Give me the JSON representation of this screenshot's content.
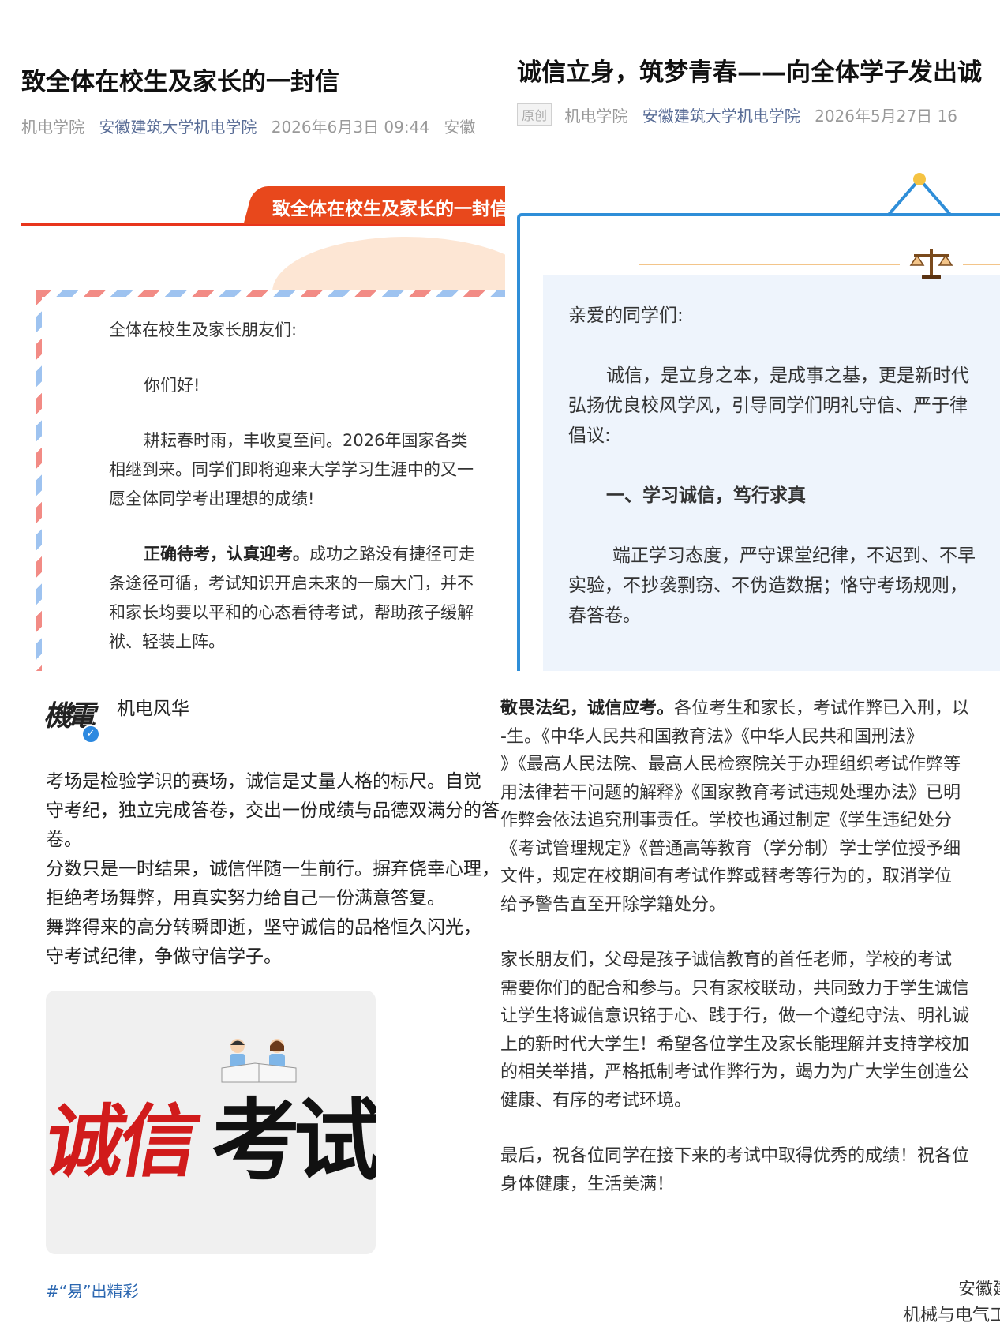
{
  "top_left": {
    "title": "致全体在校生及家长的一封信",
    "meta_source": "机电学院",
    "meta_account": "安徽建筑大学机电学院",
    "meta_date": "2026年6月3日 09:44",
    "meta_region": "安徽",
    "banner_text": "致全体在校生及家长的一封信",
    "salutation": "全体在校生及家长朋友们:",
    "greeting": "你们好!",
    "para1_line1": "耕耘春时雨，丰收夏至间。2026年国家各类",
    "para1_line2": "相继到来。同学们即将迎来大学学习生涯中的又一",
    "para1_line3": "愿全体同学考出理想的成绩!",
    "para2_bold": "正确待考，认真迎考。",
    "para2_line1_rest": "成功之路没有捷径可走",
    "para2_line2": "条途径可循，考试知识开启未来的一扇大门，并不",
    "para2_line3": "和家长均要以平和的心态看待考试，帮助孩子缓解",
    "para2_line4": "袱、轻装上阵。"
  },
  "top_right": {
    "title": "诚信立身，筑梦青春——向全体学子发出诚",
    "meta_tag": "原创",
    "meta_source": "机电学院",
    "meta_account": "安徽建筑大学机电学院",
    "meta_date": "2026年5月27日 16",
    "salutation": "亲爱的同学们:",
    "para1_line1": "诚信，是立身之本，是成事之基，更是新时代",
    "para1_line2": "弘扬优良校风学风，引导同学们明礼守信、严于律",
    "para1_line3": "倡议:",
    "heading1": "一、学习诚信，笃行求真",
    "para2_line1": "端正学习态度，严守课堂纪律，不迟到、不早",
    "para2_line2": "实验，不抄袭剽窃、不伪造数据；恪守考场规则，",
    "para2_line3": "春答卷。"
  },
  "bottom_left": {
    "account_name": "机电风华",
    "logo_text": "機電",
    "post_lines": [
      "考场是检验学识的赛场，诚信是丈量人格的标尺。自觉",
      "守考纪，独立完成答卷，交出一份成绩与品德双满分的答",
      "卷。",
      "分数只是一时结果，诚信伴随一生前行。摒弃侥幸心理，",
      "拒绝考场舞弊，用真实努力给自己一份满意答复。",
      "舞弊得来的高分转瞬即逝，坚守诚信的品格恒久闪光，",
      "守考试纪律，争做守信学子。"
    ],
    "image_text_red": "诚信",
    "image_text_black": "考试",
    "hashtag": "#“易”出精彩"
  },
  "bottom_right": {
    "para1_bold": "敬畏法纪，诚信应考。",
    "para1_line1_rest": "各位考生和家长，考试作弊已入刑，以",
    "para1_lines": [
      "-生。《中华人民共和国教育法》《中华人民共和国刑法》",
      "》《最高人民法院、最高人民检察院关于办理组织考试作弊等",
      "用法律若干问题的解释》《国家教育考试违规处理办法》已明",
      "作弊会依法追究刑事责任。学校也通过制定《学生违纪处分",
      "《考试管理规定》《普通高等教育（学分制）学士学位授予细",
      "文件，规定在校期间有考试作弊或替考等行为的，取消学位",
      "给予警告直至开除学籍处分。"
    ],
    "para2_lines": [
      "家长朋友们，父母是孩子诚信教育的首任老师，学校的考试",
      "需要你们的配合和参与。只有家校联动，共同致力于学生诚信",
      "让学生将诚信意识铭于心、践于行，做一个遵纪守法、明礼诚",
      "上的新时代大学生！希望各位学生及家长能理解并支持学校加",
      "的相关举措，严格抵制考试作弊行为，竭力为广大学生创造公",
      "健康、有序的考试环境。"
    ],
    "para3_lines": [
      "最后，祝各位同学在接下来的考试中取得优秀的成绩！祝各位",
      "身体健康，生活美满！"
    ],
    "sign1": "安徽建",
    "sign2": "机械与电气工"
  },
  "colors": {
    "banner_red": "#e8481c",
    "link_blue": "#576b95",
    "card_blue": "#2f8ed8",
    "card_bg": "#eef4fc",
    "hashtag_blue": "#2a66b0",
    "image_red": "#d11b1b"
  }
}
